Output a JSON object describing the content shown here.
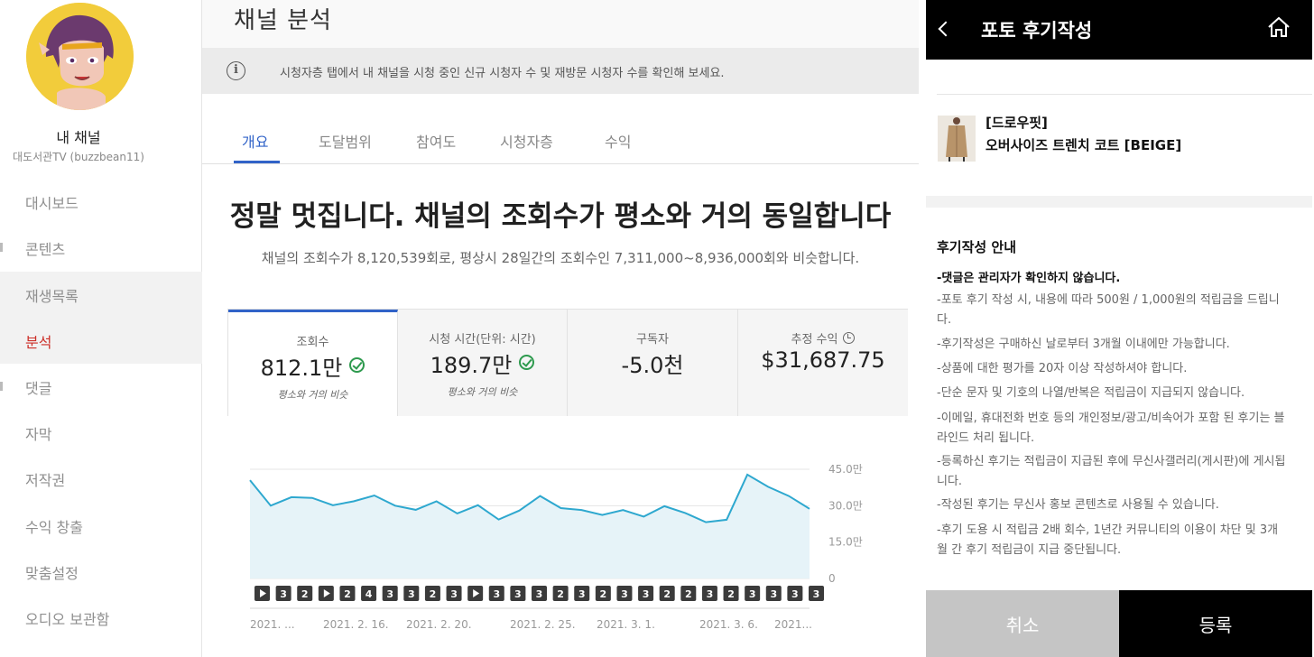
{
  "studio": {
    "sidebar": {
      "channel_label": "내 채널",
      "channel_handle": "대도서관TV (buzzbean11)",
      "items": [
        {
          "label": "대시보드"
        },
        {
          "label": "콘텐츠"
        },
        {
          "label": "재생목록"
        },
        {
          "label": "분석"
        },
        {
          "label": "댓글"
        },
        {
          "label": "자막"
        },
        {
          "label": "저작권"
        },
        {
          "label": "수익 창출"
        },
        {
          "label": "맞춤설정"
        },
        {
          "label": "오디오 보관함"
        }
      ],
      "active_item": "분석"
    },
    "page_title": "채널 분석",
    "info_text": "시청자층 탭에서 내 채널을 시청 중인 신규 시청자 수 및 재방문 시청자 수를 확인해 보세요.",
    "tabs": [
      "개요",
      "도달범위",
      "참여도",
      "시청자층",
      "수익"
    ],
    "active_tab": "개요",
    "headline": "정말 멋집니다. 채널의 조회수가 평소와 거의 동일합니다",
    "subline": "채널의 조회수가 8,120,539회로, 평상시 28일간의 조회수인 7,311,000~8,936,000회와 비슷합니다.",
    "cards": [
      {
        "label": "조회수",
        "value": "812.1만",
        "note": "평소와 거의 비슷",
        "check": true
      },
      {
        "label": "시청 시간(단위: 시간)",
        "value": "189.7만",
        "note": "평소와 거의 비슷",
        "check": true
      },
      {
        "label": "구독자",
        "value": "-5.0천",
        "note": "",
        "check": false
      },
      {
        "label": "추정 수익",
        "value": "$31,687.75",
        "note": "",
        "check": false
      }
    ],
    "accent_color": "#3163c8",
    "line_color": "#2ea8cf"
  },
  "chart_data": {
    "type": "area",
    "title": "",
    "xlabel": "",
    "ylabel": "",
    "ylim": [
      0,
      450000
    ],
    "ytick_labels": [
      "45.0만",
      "30.0만",
      "15.0만",
      "0"
    ],
    "yticks": [
      450000,
      300000,
      150000,
      0
    ],
    "x_tick_labels": [
      "2021. ...",
      "2021. 2. 16.",
      "2021. 2. 20.",
      "2021. 2. 25.",
      "2021. 3. 1.",
      "2021. 3. 6.",
      "2021..."
    ],
    "series": [
      {
        "values": [
          405000,
          300000,
          335000,
          332000,
          302000,
          318000,
          342000,
          300000,
          283000,
          318000,
          268000,
          302000,
          243000,
          280000,
          340000,
          290000,
          282000,
          262000,
          282000,
          255000,
          298000,
          270000,
          232000,
          242000,
          428000,
          378000,
          340000,
          287000
        ]
      }
    ],
    "video_markers": [
      "▶",
      "3",
      "2",
      "▶",
      "2",
      "4",
      "3",
      "3",
      "2",
      "3",
      "▶",
      "3",
      "3",
      "3",
      "2",
      "3",
      "2",
      "3",
      "3",
      "2",
      "2",
      "3",
      "2",
      "3",
      "3",
      "3",
      "3"
    ],
    "grid": true
  },
  "review": {
    "header_title": "포토 후기작성",
    "product_brand": "[드로우핏]",
    "product_name": "오버사이즈 트렌치 코트 [BEIGE]",
    "guide_title": "후기작성 안내",
    "guide_first": "-댓글은 관리자가 확인하지 않습니다.",
    "guide_lines": [
      "-포토 후기 작성 시, 내용에 따라 500원 / 1,000원의 적립금을 드립니다.",
      "-후기작성은 구매하신 날로부터 3개월 이내에만 가능합니다.",
      "-상품에 대한 평가를 20자 이상 작성하셔야 합니다.",
      "-단순 문자 및 기호의 나열/반복은 적립금이 지급되지 않습니다.",
      "-이메일, 휴대전화 번호 등의 개인정보/광고/비속어가 포함 된 후기는 블라인드 처리 됩니다.",
      "-등록하신 후기는 적립금이 지급된 후에 무신사갤러리(게시판)에 게시됩니다.",
      "-작성된 후기는 무신사 홍보 콘텐츠로 사용될 수 있습니다.",
      "-후기 도용 시 적립금 2배 회수, 1년간 커뮤니티의 이용이 차단 및 3개월 간 후기 적립금이 지급 중단됩니다."
    ],
    "cancel_label": "취소",
    "submit_label": "등록"
  }
}
